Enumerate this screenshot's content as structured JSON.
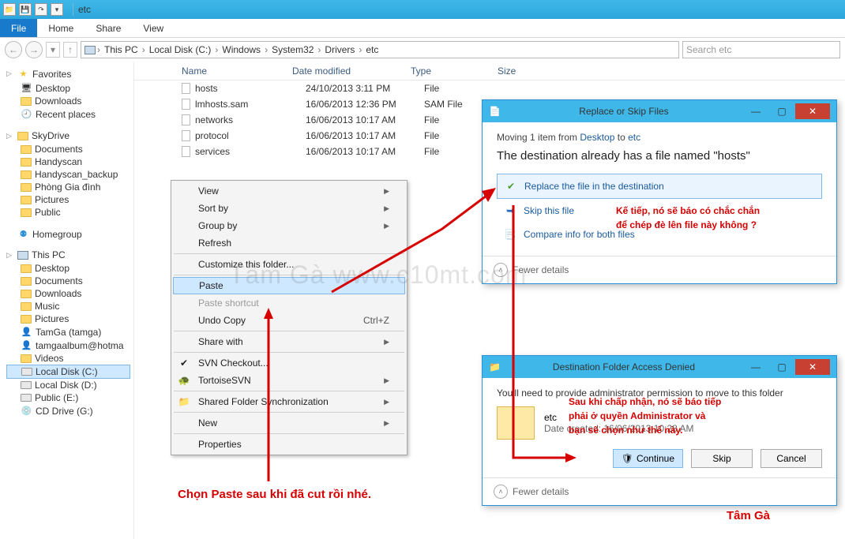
{
  "titlebar": {
    "title": "etc"
  },
  "ribbon": {
    "file": "File",
    "home": "Home",
    "share": "Share",
    "view": "View"
  },
  "breadcrumb": [
    "This PC",
    "Local Disk (C:)",
    "Windows",
    "System32",
    "Drivers",
    "etc"
  ],
  "search_placeholder": "Search etc",
  "sidebar": {
    "favorites": {
      "label": "Favorites",
      "items": [
        "Desktop",
        "Downloads",
        "Recent places"
      ]
    },
    "skydrive": {
      "label": "SkyDrive",
      "items": [
        "Documents",
        "Handyscan",
        "Handyscan_backup",
        "Phòng Gia đình",
        "Pictures",
        "Public"
      ]
    },
    "homegroup": {
      "label": "Homegroup"
    },
    "thispc": {
      "label": "This PC",
      "items": [
        "Desktop",
        "Documents",
        "Downloads",
        "Music",
        "Pictures",
        "TamGa (tamga)",
        "tamgaalbum@hotma",
        "Videos",
        "Local Disk (C:)",
        "Local Disk (D:)",
        "Public (E:)",
        "CD Drive (G:)"
      ]
    }
  },
  "columns": {
    "name": "Name",
    "date": "Date modified",
    "type": "Type",
    "size": "Size"
  },
  "files": [
    {
      "name": "hosts",
      "date": "24/10/2013 3:11 PM",
      "type": "File"
    },
    {
      "name": "lmhosts.sam",
      "date": "16/06/2013 12:36 PM",
      "type": "SAM File"
    },
    {
      "name": "networks",
      "date": "16/06/2013 10:17 AM",
      "type": "File"
    },
    {
      "name": "protocol",
      "date": "16/06/2013 10:17 AM",
      "type": "File"
    },
    {
      "name": "services",
      "date": "16/06/2013 10:17 AM",
      "type": "File"
    }
  ],
  "context_menu": {
    "view": "View",
    "sortby": "Sort by",
    "groupby": "Group by",
    "refresh": "Refresh",
    "customize": "Customize this folder...",
    "paste": "Paste",
    "paste_shortcut": "Paste shortcut",
    "undo_copy": "Undo Copy",
    "undo_short": "Ctrl+Z",
    "sharewith": "Share with",
    "svn_checkout": "SVN Checkout...",
    "tortoisesvn": "TortoiseSVN",
    "shared_sync": "Shared Folder Synchronization",
    "new": "New",
    "properties": "Properties"
  },
  "dialog1": {
    "title": "Replace or Skip Files",
    "moving_prefix": "Moving 1 item from ",
    "from": "Desktop",
    "to_word": " to ",
    "to": "etc",
    "msg": "The destination already has a file named \"hosts\"",
    "opt_replace": "Replace the file in the destination",
    "opt_skip": "Skip this file",
    "opt_compare": "Compare info for both files",
    "fewer": "Fewer details"
  },
  "dialog2": {
    "title": "Destination Folder Access Denied",
    "msg": "You'll need to provide administrator permission to move to this folder",
    "folder_name": "etc",
    "date_label": "Date created: 16/06/2013 10:28 AM",
    "continue": "Continue",
    "skip": "Skip",
    "cancel": "Cancel",
    "fewer": "Fewer details"
  },
  "annotations": {
    "red1": "Chọn Paste sau khi đã cut rồi nhé.",
    "red2a": "Kế tiếp, nó sẽ báo có chắc chắn",
    "red2b": "để chép đè lên file này không ?",
    "red3a": "Sau khi chấp nhận, nó sẽ báo tiếp",
    "red3b": "phải ở quyền Administrator và",
    "red3c": "bạn sẽ chọn như thế này.",
    "signature": "Tâm Gà",
    "watermark": "Tâm Gà   www.c10mt.com"
  }
}
